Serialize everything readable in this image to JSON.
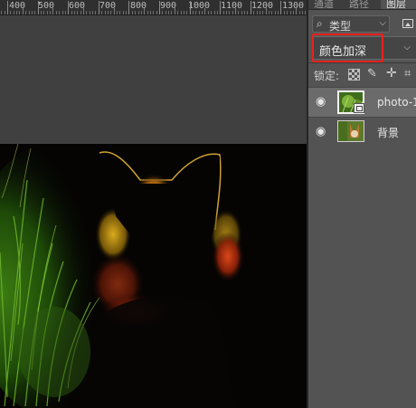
{
  "ruler": {
    "labels": [
      "400",
      "500",
      "600",
      "700",
      "800",
      "900",
      "1000",
      "1100",
      "1200",
      "1300"
    ]
  },
  "panel": {
    "tabs": [
      "通道",
      "路径",
      "图层"
    ],
    "filter": {
      "icon": "search-icon",
      "label": "类型"
    },
    "blend_mode": "颜色加深",
    "lock_label": "锁定:",
    "layers": [
      {
        "name": "photo-1",
        "selected": true,
        "visible": true,
        "smart_object": true
      },
      {
        "name": "背景",
        "selected": false,
        "visible": true,
        "smart_object": false
      }
    ]
  },
  "colors": {
    "highlight_box": "#e8221e",
    "panel_bg": "#535353",
    "workspace_bg": "#404040"
  }
}
